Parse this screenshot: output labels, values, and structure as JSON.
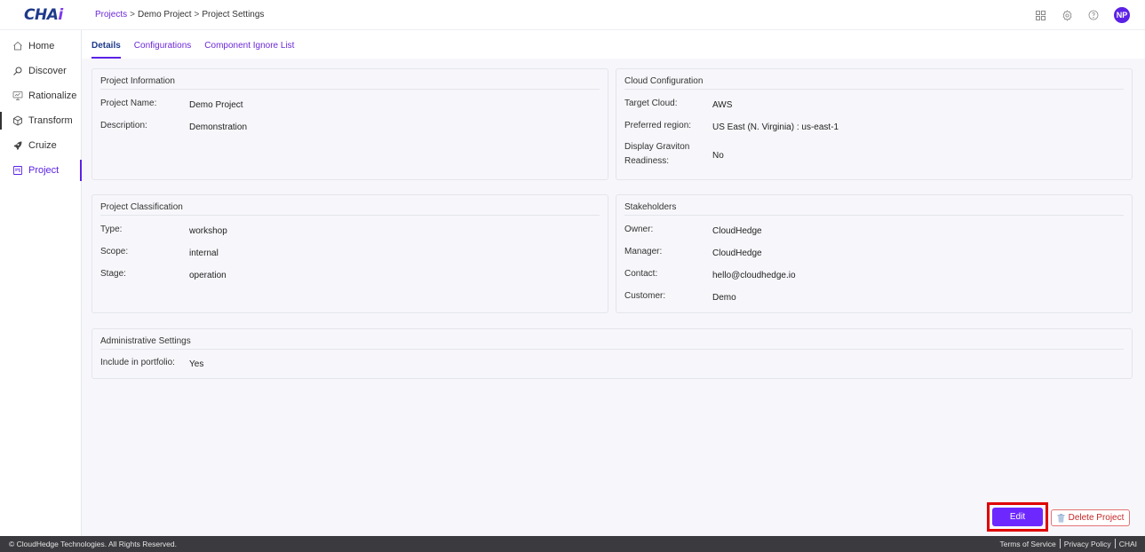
{
  "app": {
    "logo_main": "CHA",
    "logo_accent": "i",
    "breadcrumb": [
      {
        "label": "Projects"
      },
      {
        "label": "Demo Project"
      },
      {
        "label": "Project Settings"
      }
    ],
    "breadcrumb_sep": ">",
    "user_initials": "NP"
  },
  "sidebar": {
    "items": [
      {
        "label": "Home",
        "icon": "home-icon"
      },
      {
        "label": "Discover",
        "icon": "search-icon"
      },
      {
        "label": "Rationalize",
        "icon": "monitor-icon"
      },
      {
        "label": "Transform",
        "icon": "cube-icon"
      },
      {
        "label": "Cruize",
        "icon": "rocket-icon"
      },
      {
        "label": "Project",
        "icon": "project-icon",
        "active": true
      }
    ]
  },
  "tabs": [
    {
      "label": "Details",
      "active": true
    },
    {
      "label": "Configurations"
    },
    {
      "label": "Component Ignore List"
    }
  ],
  "project_information": {
    "title": "Project Information",
    "rows": [
      {
        "label": "Project Name:",
        "value": "Demo Project"
      },
      {
        "label": "Description:",
        "value": "Demonstration"
      }
    ]
  },
  "cloud_configuration": {
    "title": "Cloud Configuration",
    "rows": [
      {
        "label": "Target Cloud:",
        "value": "AWS"
      },
      {
        "label": "Preferred region:",
        "value": "US East (N. Virginia) : us-east-1"
      },
      {
        "label": "Display Graviton Readiness:",
        "value": "No"
      }
    ]
  },
  "project_classification": {
    "title": "Project Classification",
    "rows": [
      {
        "label": "Type:",
        "value": "workshop"
      },
      {
        "label": "Scope:",
        "value": "internal"
      },
      {
        "label": "Stage:",
        "value": "operation"
      }
    ]
  },
  "stakeholders": {
    "title": "Stakeholders",
    "rows": [
      {
        "label": "Owner:",
        "value": "CloudHedge"
      },
      {
        "label": "Manager:",
        "value": "CloudHedge"
      },
      {
        "label": "Contact:",
        "value": "hello@cloudhedge.io"
      },
      {
        "label": "Customer:",
        "value": "Demo"
      }
    ]
  },
  "administrative_settings": {
    "title": "Administrative Settings",
    "rows": [
      {
        "label": "Include in portfolio:",
        "value": "Yes"
      }
    ]
  },
  "actions": {
    "edit_label": "Edit",
    "delete_label": "Delete Project"
  },
  "footer": {
    "copyright": "© CloudHedge Technologies. All Rights Reserved.",
    "links": [
      "Terms of Service",
      "Privacy Policy",
      "CHAI"
    ]
  },
  "colors": {
    "accent": "#5b21e6",
    "edit_button": "#6d28ff",
    "delete": "#c62828",
    "highlight_box": "#e00000",
    "footer_bg": "#3a3a3f"
  }
}
